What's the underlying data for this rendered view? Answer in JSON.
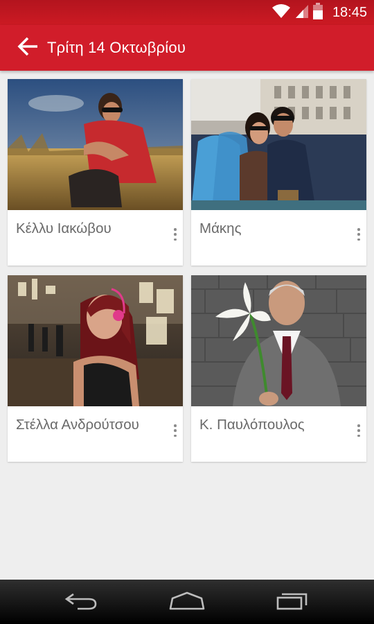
{
  "status_bar": {
    "time": "18:45",
    "icons": [
      "wifi-icon",
      "signal-icon",
      "battery-icon"
    ]
  },
  "app_bar": {
    "title": "Τρίτη 14 Οκτωβρίου",
    "back_icon": "arrow-back-icon"
  },
  "cards": [
    {
      "name": "Κέλλυ Ιακώβου",
      "menu_icon": "more-vert-icon"
    },
    {
      "name": "Μάκης",
      "menu_icon": "more-vert-icon"
    },
    {
      "name": "Στέλλα Ανδρούτσου",
      "menu_icon": "more-vert-icon"
    },
    {
      "name": "Κ. Παυλόπουλος",
      "menu_icon": "more-vert-icon"
    }
  ],
  "nav_bar": {
    "icons": [
      "back-icon",
      "home-icon",
      "recents-icon"
    ]
  },
  "colors": {
    "primary": "#d11d2a",
    "status_bar": "#b3141e",
    "background": "#eeeeee",
    "card": "#ffffff",
    "name_text": "#6a6a6a"
  }
}
